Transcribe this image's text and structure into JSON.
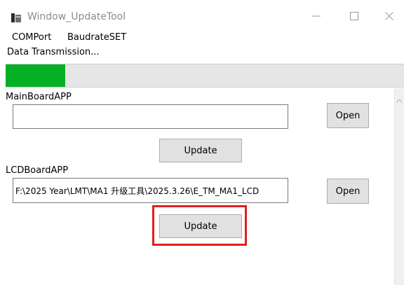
{
  "window": {
    "title": "Window_UpdateTool",
    "controls": {
      "minimize_icon": "minimize-icon",
      "maximize_icon": "maximize-icon",
      "close_icon": "close-icon"
    }
  },
  "menu": {
    "items": [
      {
        "label": "COMPort"
      },
      {
        "label": "BaudrateSET"
      }
    ]
  },
  "status": {
    "text": "Data Transmission..."
  },
  "progress": {
    "value_percent": 15,
    "fill_color": "#06b025",
    "track_color": "#e6e6e6"
  },
  "main_board": {
    "label": "MainBoardAPP",
    "path_value": "",
    "open_label": "Open",
    "update_label": "Update"
  },
  "lcd_board": {
    "label": "LCDBoardAPP",
    "path_value": "F:\\2025 Year\\LMT\\MA1 升级工具\\2025.3.26\\E_TM_MA1_LCD",
    "open_label": "Open",
    "update_label": "Update"
  },
  "colors": {
    "highlight": "#e0201e",
    "button_bg": "#e1e1e1",
    "title_text": "#8c8c8c"
  }
}
